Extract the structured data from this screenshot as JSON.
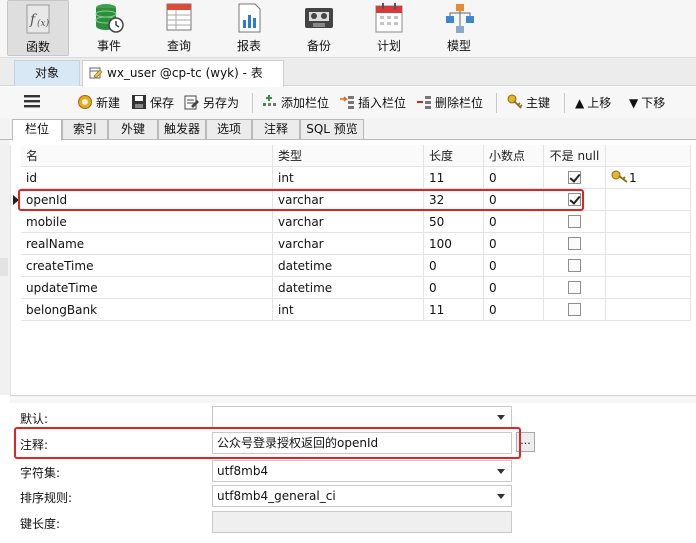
{
  "ribbon": {
    "items": [
      {
        "label": "函数",
        "icon": "function-icon",
        "active": true
      },
      {
        "label": "事件",
        "icon": "event-icon"
      },
      {
        "label": "查询",
        "icon": "query-icon"
      },
      {
        "label": "报表",
        "icon": "report-icon"
      },
      {
        "label": "备份",
        "icon": "backup-icon"
      },
      {
        "label": "计划",
        "icon": "schedule-icon"
      },
      {
        "label": "模型",
        "icon": "model-icon"
      }
    ]
  },
  "tabs": {
    "object_label": "对象",
    "file_label": "wx_user @cp-tc (wyk) - 表"
  },
  "toolbar": {
    "menu_icon": "hamburger-icon",
    "new": "新建",
    "save": "保存",
    "save_as": "另存为",
    "add_column": "添加栏位",
    "insert_column": "插入栏位",
    "delete_column": "删除栏位",
    "primary_key": "主键",
    "move_up": "上移",
    "move_down": "下移"
  },
  "subtabs": [
    "栏位",
    "索引",
    "外键",
    "触发器",
    "选项",
    "注释",
    "SQL 预览"
  ],
  "grid": {
    "headers": {
      "name": "名",
      "type": "类型",
      "length": "长度",
      "decimals": "小数点",
      "not_null": "不是 null",
      "key": ""
    },
    "rows": [
      {
        "name": "id",
        "type": "int",
        "length": "11",
        "decimals": "0",
        "not_null": true,
        "key": "1"
      },
      {
        "name": "openId",
        "type": "varchar",
        "length": "32",
        "decimals": "0",
        "not_null": true,
        "key": "",
        "selected": true
      },
      {
        "name": "mobile",
        "type": "varchar",
        "length": "50",
        "decimals": "0",
        "not_null": false,
        "key": ""
      },
      {
        "name": "realName",
        "type": "varchar",
        "length": "100",
        "decimals": "0",
        "not_null": false,
        "key": ""
      },
      {
        "name": "createTime",
        "type": "datetime",
        "length": "0",
        "decimals": "0",
        "not_null": false,
        "key": ""
      },
      {
        "name": "updateTime",
        "type": "datetime",
        "length": "0",
        "decimals": "0",
        "not_null": false,
        "key": ""
      },
      {
        "name": "belongBank",
        "type": "int",
        "length": "11",
        "decimals": "0",
        "not_null": false,
        "key": ""
      }
    ]
  },
  "props": {
    "default_label": "默认:",
    "default_value": "",
    "comment_label": "注释:",
    "comment_value": "公众号登录授权返回的openId",
    "charset_label": "字符集:",
    "charset_value": "utf8mb4",
    "collation_label": "排序规则:",
    "collation_value": "utf8mb4_general_ci",
    "key_length_label": "键长度:",
    "key_length_value": "",
    "ellipsis": "..."
  },
  "colors": {
    "highlight": "#e02424",
    "accent": "#d8e8f5"
  }
}
